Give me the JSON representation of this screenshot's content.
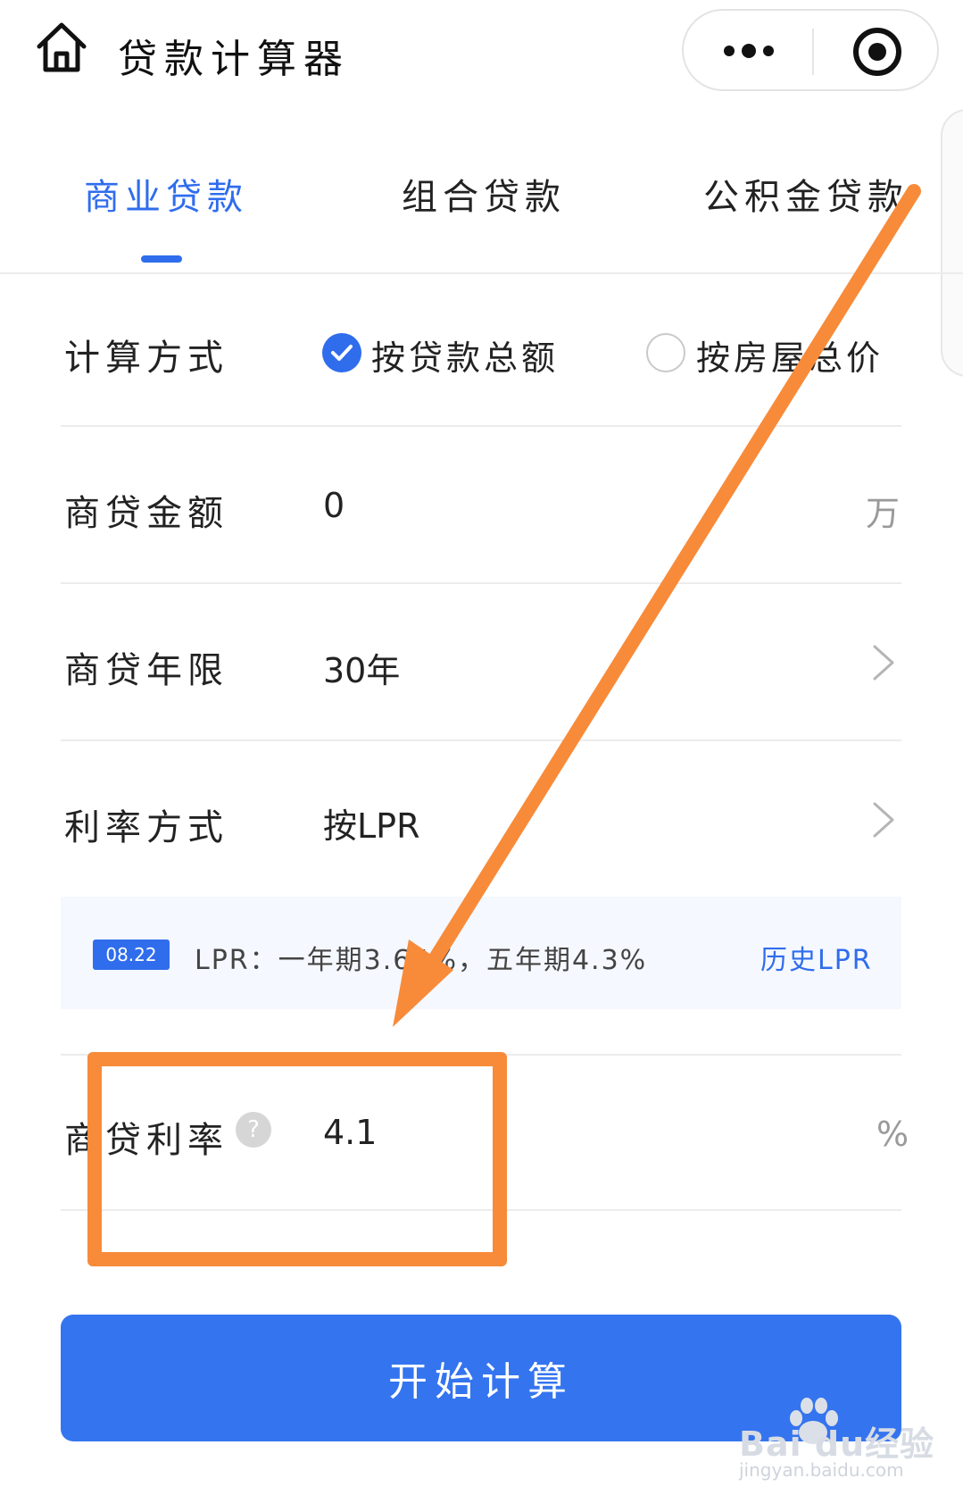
{
  "header": {
    "title": "贷款计算器",
    "home_icon": "home-icon",
    "more_icon": "more-dots-icon",
    "close_icon": "target-circle-icon"
  },
  "tabs": [
    {
      "label": "商业贷款",
      "active": true
    },
    {
      "label": "组合贷款",
      "active": false
    },
    {
      "label": "公积金贷款",
      "active": false
    }
  ],
  "form": {
    "method": {
      "label": "计算方式",
      "options": [
        {
          "label": "按贷款总额",
          "selected": true
        },
        {
          "label": "按房屋总价",
          "selected": false
        }
      ]
    },
    "amount": {
      "label": "商贷金额",
      "value": "0",
      "unit": "万"
    },
    "term": {
      "label": "商贷年限",
      "value": "30年"
    },
    "rate_mode": {
      "label": "利率方式",
      "value": "按LPR"
    },
    "lpr_info": {
      "date_badge": "08.22",
      "text": "LPR：一年期3.65%，五年期4.3%",
      "link": "历史LPR"
    },
    "rate": {
      "label": "商贷利率",
      "value": "4.1",
      "unit": "%",
      "help_icon": "?"
    }
  },
  "submit_label": "开始计算",
  "watermark": {
    "logo": "Bai du经验",
    "url": "jingyan.baidu.com"
  },
  "colors": {
    "accent": "#2f6ded",
    "button": "#3474ef",
    "annotation": "#f78b3a",
    "lpr_bg": "#f5f8fe"
  }
}
